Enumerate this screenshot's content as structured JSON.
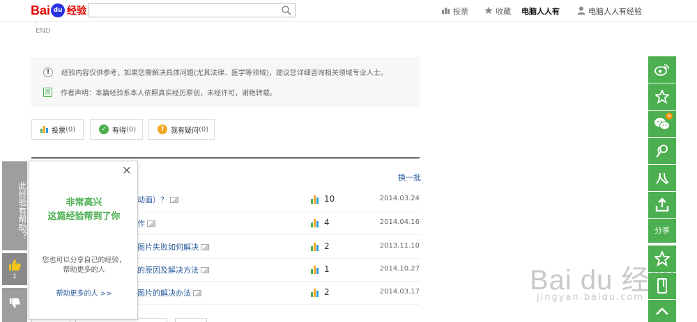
{
  "header": {
    "logo_text_left": "Bai",
    "logo_paw": "du",
    "logo_text_right": "经验",
    "search_placeholder": "",
    "nav": {
      "vote": "投票",
      "favorite": "收藏",
      "author_brand": "电脑人人有",
      "user": "电脑人人有经验"
    }
  },
  "end_label": "END",
  "notice": {
    "line1": "经验内容仅供参考，如果您需解决具体问题(尤其法律、医学等领域)，建议您详细咨询相关领域专业人士。",
    "line2": "作者声明：本篇经验系本人依照真实经历原创，未经许可，谢绝转载。",
    "badge1": "!",
    "badge2": "原"
  },
  "actions": {
    "vote_label": "投票",
    "vote_count": "(0)",
    "useful_label": "有得",
    "useful_count": "(0)",
    "question_label": "我有疑问",
    "question_count": "(0)"
  },
  "list": {
    "change_batch": "换一批",
    "items": [
      {
        "title": "动画）？",
        "count": "10",
        "date": "2014.03.24"
      },
      {
        "title": "作",
        "count": "4",
        "date": "2014.04.16"
      },
      {
        "title": "图片失败如何解决",
        "count": "2",
        "date": "2013.11.10"
      },
      {
        "title": "的原因及解决方法",
        "count": "1",
        "date": "2014.10.27"
      },
      {
        "title": "图片的解决办法",
        "count": "2",
        "date": "2014.03.17"
      }
    ]
  },
  "helpful_bar": {
    "question_text": "此经验有帮助？",
    "thumb_up_count": "1"
  },
  "popup": {
    "close": "×",
    "headline1": "非常高兴",
    "headline2": "这篇经验帮到了你",
    "sub1": "您也可以分享自己的经验，",
    "sub2": "帮助更多的人",
    "more_link": "帮助更多的人 >>"
  },
  "share_bar": {
    "label": "分享",
    "wechat_badge": "N"
  },
  "watermark": {
    "big": "Bai du 经验",
    "url": "jingyan.baidu.com"
  },
  "colors": {
    "green": "#4caf50",
    "link_blue": "#2b5c9e",
    "baidu_red": "#e10602",
    "baidu_blue": "#2932e1"
  }
}
